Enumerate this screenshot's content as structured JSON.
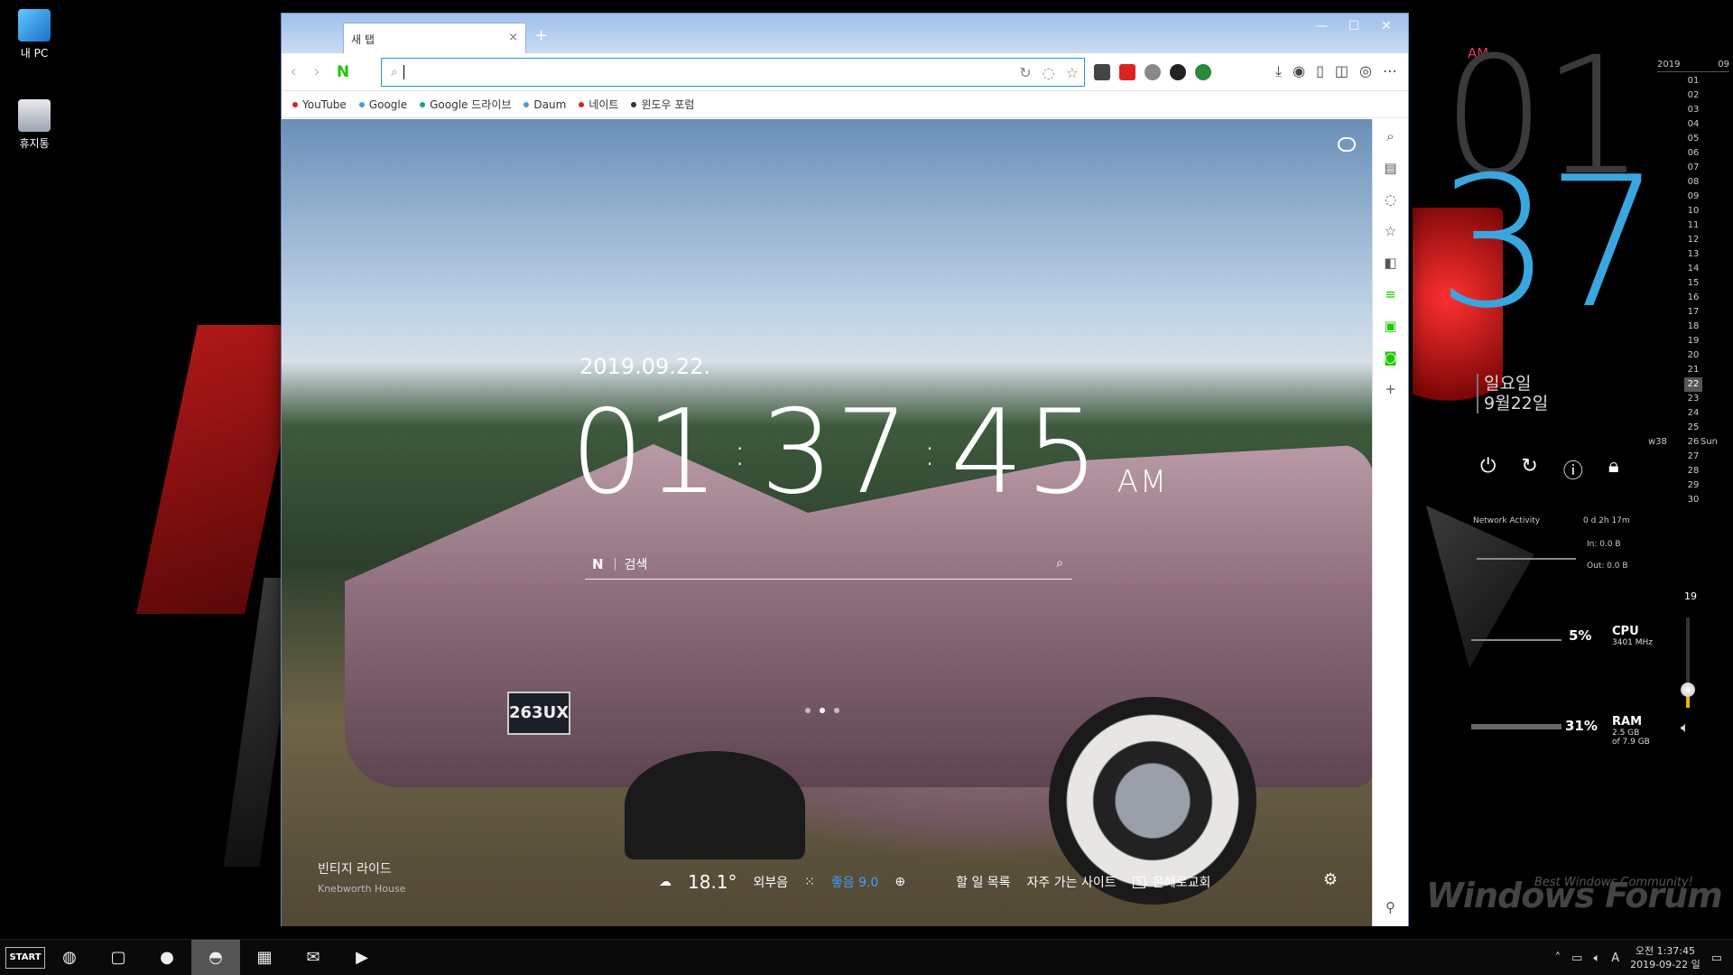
{
  "desktop": {
    "icons": [
      {
        "label": "내 PC"
      },
      {
        "label": "휴지통"
      }
    ]
  },
  "browser": {
    "tab_title": "새 탭",
    "tab_close": "×",
    "new_tab": "+",
    "window_controls": {
      "minimize": "—",
      "maximize": "☐",
      "close": "✕"
    },
    "bookmarks": [
      {
        "label": "YouTube",
        "color": "#e02020"
      },
      {
        "label": "Google",
        "color": "#4a9ad8"
      },
      {
        "label": "Google 드라이브",
        "color": "#21a366"
      },
      {
        "label": "Daum",
        "color": "#4a9ad8"
      },
      {
        "label": "네이트",
        "color": "#e02020"
      },
      {
        "label": "윈도우 포럼",
        "color": "#333333"
      }
    ]
  },
  "newtab": {
    "date": "2019.09.22.",
    "clock": {
      "hh": "01",
      "mm": "37",
      "ss": "45",
      "ampm": "AM"
    },
    "search_logo": "N",
    "search_placeholder": "검색",
    "photo_title": "빈티지 라이드",
    "photo_location": "Knebworth House",
    "weather": {
      "temp": "18.1°",
      "condition": "외부음",
      "dust": "좋음 9.0"
    },
    "links": {
      "todo": "할 일 목록",
      "frequent": "자주 가는 사이트",
      "badge": "5",
      "church": "은혜로교회"
    },
    "plate": "263UX"
  },
  "widgets": {
    "clock": {
      "am": "AM",
      "hour": "01",
      "minute": "37",
      "weekday": "일요일",
      "date": "9월22일"
    },
    "calendar": {
      "year": "2019",
      "month": "09",
      "days": [
        "01",
        "02",
        "03",
        "04",
        "05",
        "06",
        "07",
        "08",
        "09",
        "10",
        "11",
        "12",
        "13",
        "14",
        "15",
        "16",
        "17",
        "18",
        "19",
        "20",
        "21",
        "22",
        "23",
        "24",
        "25",
        "26",
        "27",
        "28",
        "29",
        "30"
      ],
      "today": "22",
      "week": "w38",
      "weekday": "Sun"
    },
    "network": {
      "title": "Network Activity",
      "uptime": "0 d 2h 17m",
      "in": "In: 0.0 B",
      "out": "Out: 0.0 B"
    },
    "cpu": {
      "percent": "5%",
      "label": "CPU",
      "detail": "3401 MHz"
    },
    "ram": {
      "percent": "31%",
      "label": "RAM",
      "detail1": "2.5 GB",
      "detail2": "of 7.9 GB"
    },
    "volume": {
      "value": "19",
      "level": 0.19
    },
    "watermark": {
      "brand": "Windows Forum",
      "tagline": "Best Windows Community!"
    }
  },
  "taskbar": {
    "start_label": "START",
    "tray_ime": "A",
    "time": "오전 1:37:45",
    "date": "2019-09-22 일"
  }
}
